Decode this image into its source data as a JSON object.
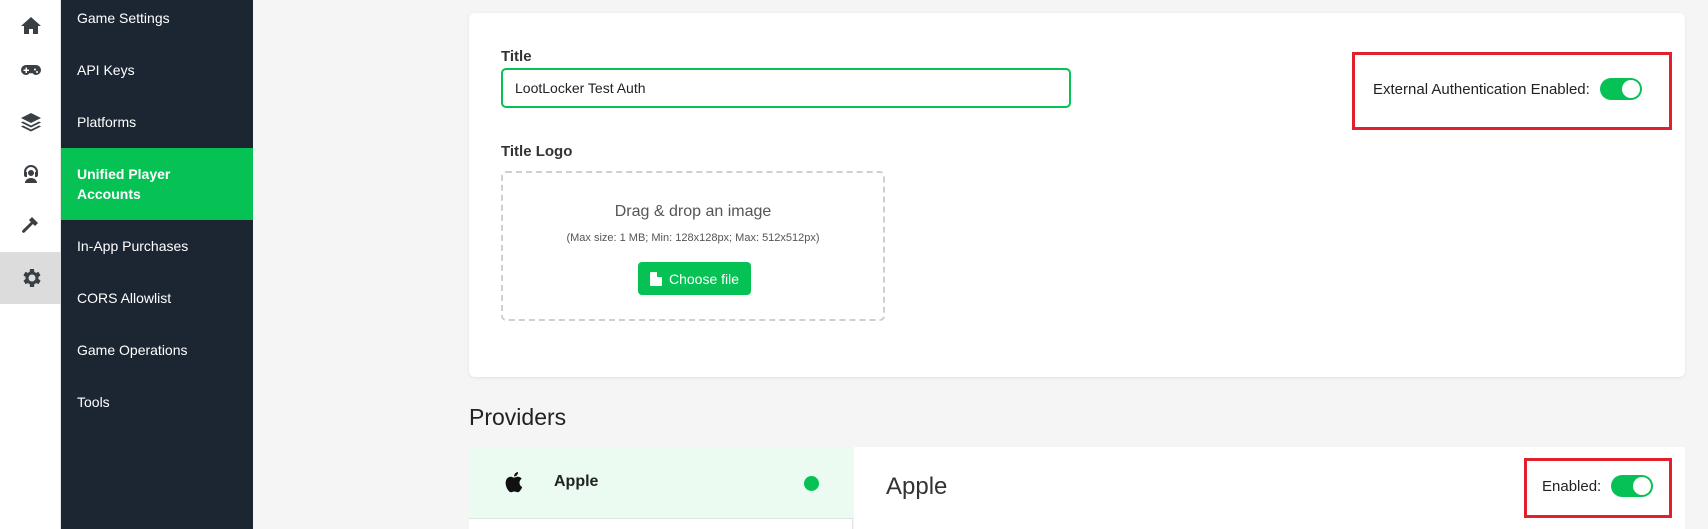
{
  "rail": {
    "icons": [
      "home-icon",
      "gamepad-icon",
      "layers-icon",
      "support-agent-icon",
      "hammer-icon",
      "gear-icon"
    ]
  },
  "nav": {
    "items": [
      {
        "label": "Game Settings"
      },
      {
        "label": "API Keys"
      },
      {
        "label": "Platforms"
      },
      {
        "label": "Unified Player Accounts",
        "active": true
      },
      {
        "label": "In-App Purchases"
      },
      {
        "label": "CORS Allowlist"
      },
      {
        "label": "Game Operations"
      },
      {
        "label": "Tools"
      }
    ]
  },
  "form": {
    "title_label": "Title",
    "title_value": "LootLocker Test Auth",
    "logo_label": "Title Logo",
    "dropzone_title": "Drag & drop an image",
    "dropzone_hint": "(Max size: 1 MB; Min: 128x128px; Max: 512x512px)",
    "choose_file_label": "Choose file",
    "external_auth_label": "External Authentication Enabled:",
    "external_auth_enabled": true
  },
  "providers": {
    "heading": "Providers",
    "items": [
      {
        "name": "Apple",
        "icon": "apple-icon",
        "status": "enabled"
      }
    ],
    "selected": {
      "title": "Apple",
      "enabled_label": "Enabled:",
      "enabled": true
    }
  },
  "colors": {
    "accent": "#06c254",
    "nav_bg": "#1b2632",
    "highlight": "#e0202c"
  }
}
